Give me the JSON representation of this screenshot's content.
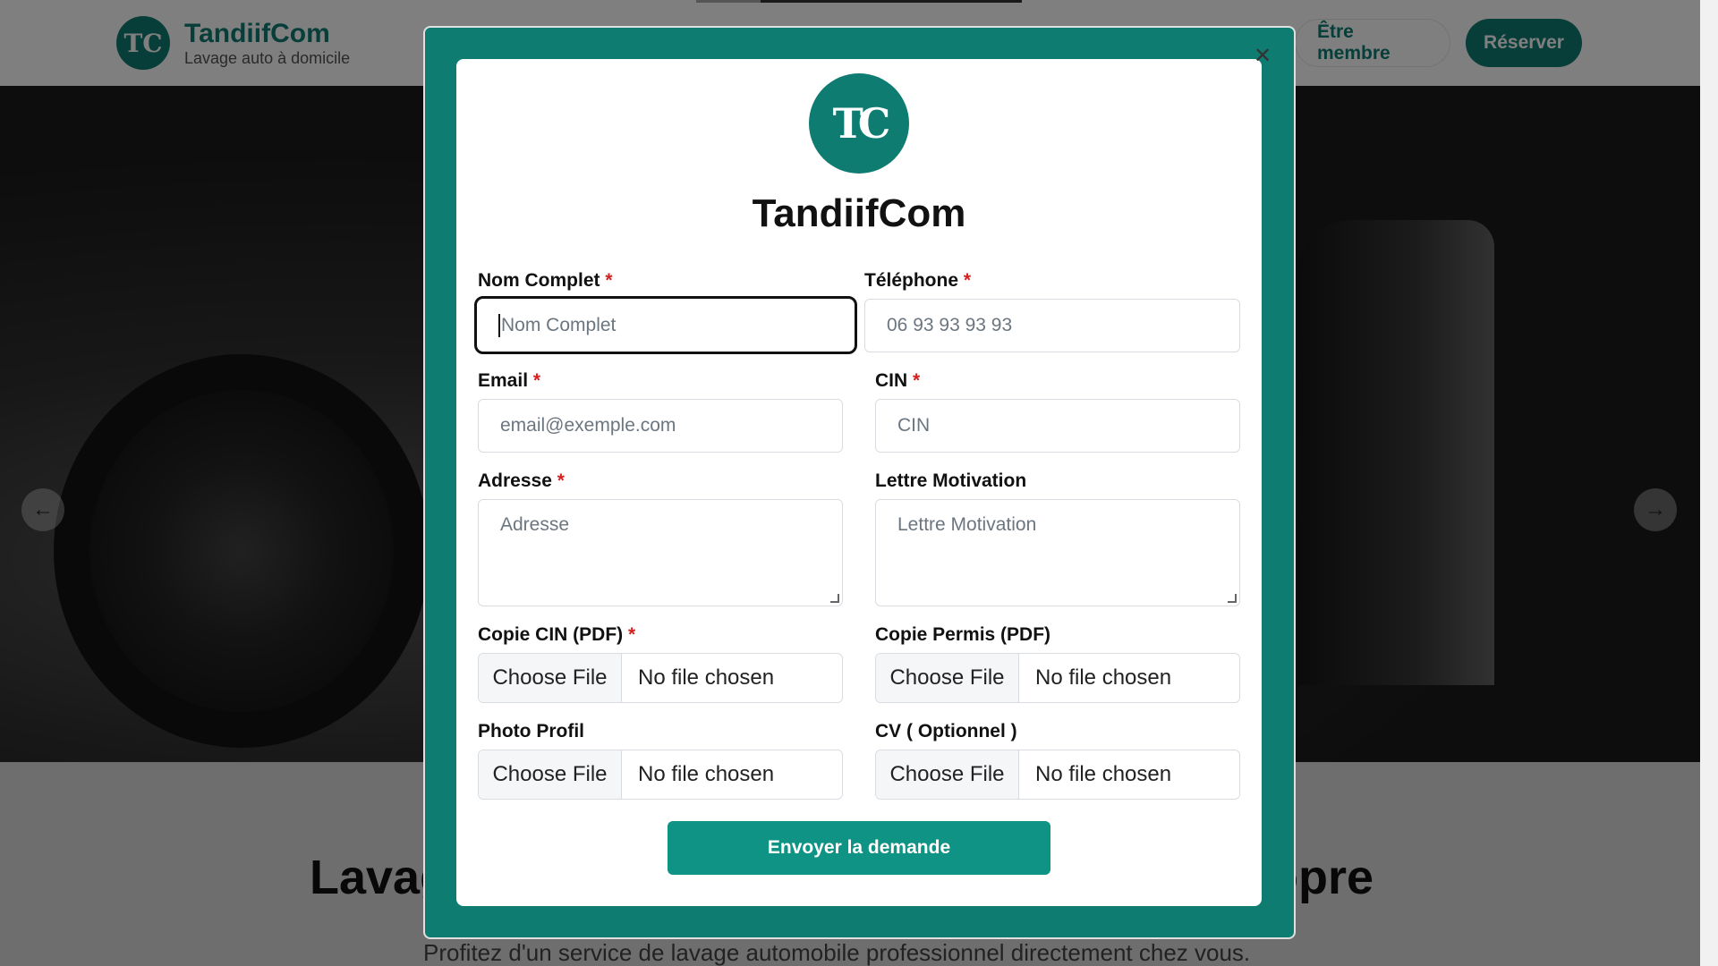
{
  "header": {
    "brand_name": "TandiifCom",
    "brand_tagline": "Lavage auto à domicile",
    "logo_glyph": "TC",
    "nav_member": "Être membre",
    "nav_book": "Réserver"
  },
  "hero": {
    "prev_icon": "arrow-left-icon",
    "next_icon": "arrow-right-icon"
  },
  "section": {
    "title_left": "Lavag",
    "title_right": "opre",
    "subtitle": "Profitez d'un service de lavage automobile professionnel directement chez vous."
  },
  "modal": {
    "logo_glyph": "TC",
    "title": "TandiifCom",
    "close_icon": "close-icon",
    "required_mark": "*",
    "fields": {
      "nom": {
        "label": "Nom Complet",
        "placeholder": "Nom Complet"
      },
      "telephone": {
        "label": "Téléphone",
        "placeholder": "06 93 93 93 93"
      },
      "email": {
        "label": "Email",
        "placeholder": "email@exemple.com"
      },
      "cin": {
        "label": "CIN",
        "placeholder": "CIN"
      },
      "adresse": {
        "label": "Adresse",
        "placeholder": "Adresse"
      },
      "lettre": {
        "label": "Lettre Motivation",
        "placeholder": "Lettre Motivation"
      }
    },
    "files": {
      "copie_cin": {
        "label": "Copie CIN (PDF)",
        "button": "Choose File",
        "status": "No file chosen"
      },
      "copie_permis": {
        "label": "Copie Permis (PDF)",
        "button": "Choose File",
        "status": "No file chosen"
      },
      "photo": {
        "label": "Photo Profil",
        "button": "Choose File",
        "status": "No file chosen"
      },
      "cv": {
        "label": "CV ( Optionnel )",
        "button": "Choose File",
        "status": "No file chosen"
      }
    },
    "submit_label": "Envoyer la demande"
  },
  "colors": {
    "brand": "#0f7c72",
    "button": "#0f9384",
    "required": "#d62020"
  }
}
